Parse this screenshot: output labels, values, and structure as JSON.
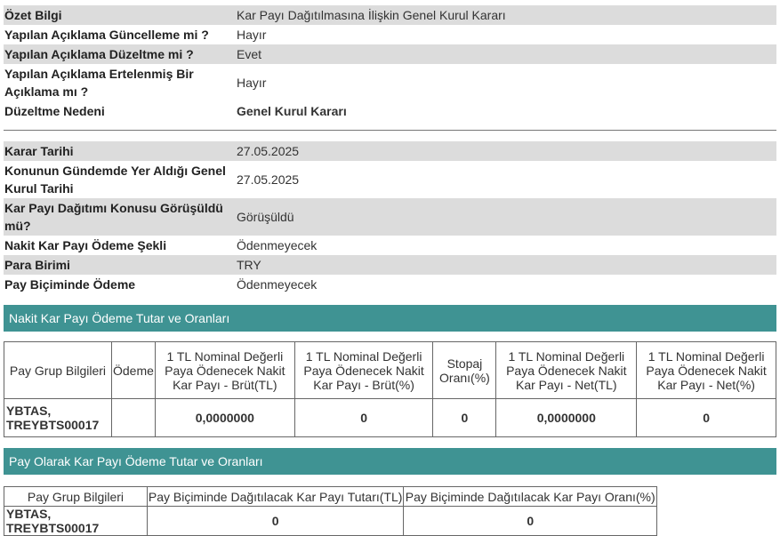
{
  "summary": [
    {
      "label": "Özet Bilgi",
      "value": "Kar Payı Dağıtılmasına İlişkin Genel Kurul Kararı"
    },
    {
      "label": "Yapılan Açıklama Güncelleme mi ?",
      "value": "Hayır"
    },
    {
      "label": "Yapılan Açıklama Düzeltme mi ?",
      "value": "Evet"
    },
    {
      "label": "Yapılan Açıklama Ertelenmiş Bir Açıklama mı ?",
      "value": "Hayır"
    },
    {
      "label": "Düzeltme Nedeni",
      "value": "Genel Kurul Kararı"
    }
  ],
  "details": [
    {
      "label": "Karar Tarihi",
      "value": "27.05.2025"
    },
    {
      "label": "Konunun Gündemde Yer Aldığı Genel Kurul Tarihi",
      "value": "27.05.2025"
    },
    {
      "label": "Kar Payı Dağıtımı Konusu Görüşüldü mü?",
      "value": "Görüşüldü"
    },
    {
      "label": "Nakit Kar Payı Ödeme Şekli",
      "value": "Ödenmeyecek"
    },
    {
      "label": "Para Birimi",
      "value": "TRY"
    },
    {
      "label": "Pay Biçiminde Ödeme",
      "value": "Ödenmeyecek"
    }
  ],
  "cash_section": {
    "title": "Nakit Kar Payı Ödeme Tutar ve Oranları",
    "headers": [
      "Pay Grup Bilgileri",
      "Ödeme",
      "1 TL Nominal Değerli Paya Ödenecek Nakit Kar Payı - Brüt(TL)",
      "1 TL Nominal Değerli Paya Ödenecek Nakit Kar Payı - Brüt(%)",
      "Stopaj Oranı(%)",
      "1 TL Nominal Değerli Paya Ödenecek Nakit Kar Payı - Net(TL)",
      "1 TL Nominal Değerli Paya Ödenecek Nakit Kar Payı - Net(%)"
    ],
    "row": [
      "YBTAS, TREYBTS00017",
      "",
      "0,0000000",
      "0",
      "0",
      "0,0000000",
      "0"
    ]
  },
  "share_section": {
    "title": "Pay Olarak Kar Payı Ödeme Tutar ve Oranları",
    "headers": [
      "Pay Grup Bilgileri",
      "Pay Biçiminde Dağıtılacak Kar Payı Tutarı(TL)",
      "Pay Biçiminde Dağıtılacak Kar Payı Oranı(%)"
    ],
    "row": [
      "YBTAS, TREYBTS00017",
      "0",
      "0"
    ]
  }
}
